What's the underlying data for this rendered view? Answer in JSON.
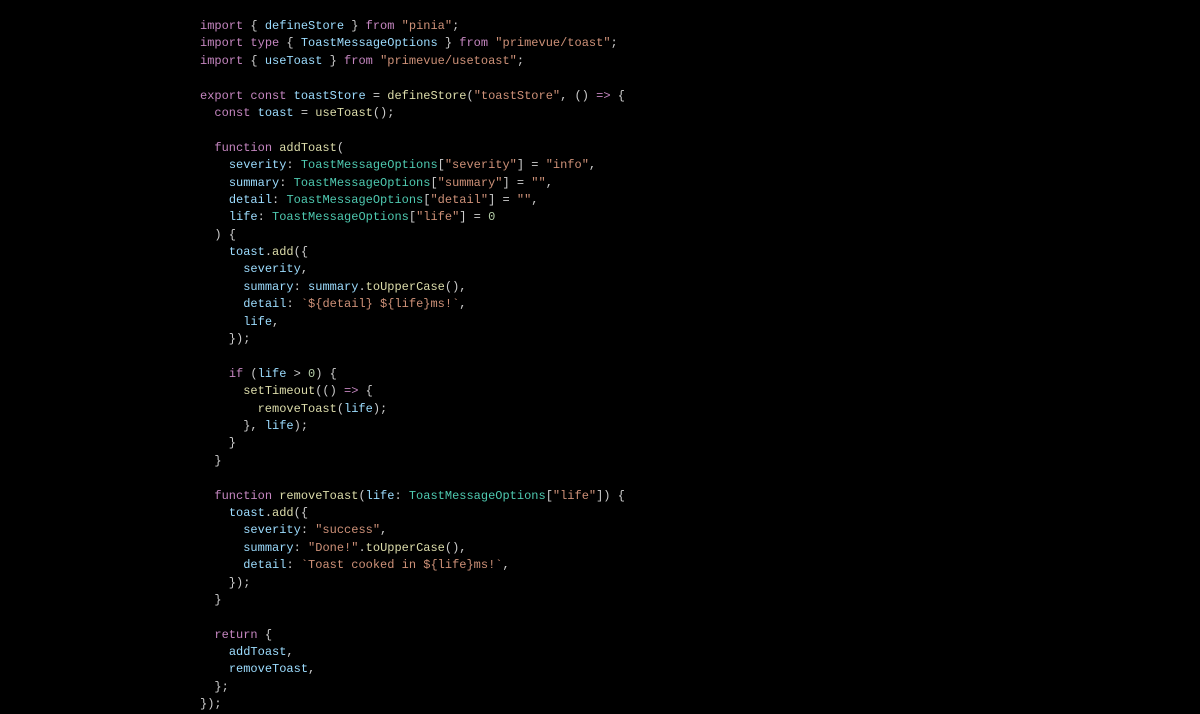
{
  "code": {
    "lines": [
      [
        {
          "c": "kw",
          "t": "import"
        },
        {
          "c": "pun",
          "t": " { "
        },
        {
          "c": "var",
          "t": "defineStore"
        },
        {
          "c": "pun",
          "t": " } "
        },
        {
          "c": "kw",
          "t": "from"
        },
        {
          "c": "pun",
          "t": " "
        },
        {
          "c": "str",
          "t": "\"pinia\""
        },
        {
          "c": "pun",
          "t": ";"
        }
      ],
      [
        {
          "c": "kw",
          "t": "import"
        },
        {
          "c": "pun",
          "t": " "
        },
        {
          "c": "kw",
          "t": "type"
        },
        {
          "c": "pun",
          "t": " { "
        },
        {
          "c": "var",
          "t": "ToastMessageOptions"
        },
        {
          "c": "pun",
          "t": " } "
        },
        {
          "c": "kw",
          "t": "from"
        },
        {
          "c": "pun",
          "t": " "
        },
        {
          "c": "str",
          "t": "\"primevue/toast\""
        },
        {
          "c": "pun",
          "t": ";"
        }
      ],
      [
        {
          "c": "kw",
          "t": "import"
        },
        {
          "c": "pun",
          "t": " { "
        },
        {
          "c": "var",
          "t": "useToast"
        },
        {
          "c": "pun",
          "t": " } "
        },
        {
          "c": "kw",
          "t": "from"
        },
        {
          "c": "pun",
          "t": " "
        },
        {
          "c": "str",
          "t": "\"primevue/usetoast\""
        },
        {
          "c": "pun",
          "t": ";"
        }
      ],
      [],
      [
        {
          "c": "kw",
          "t": "export"
        },
        {
          "c": "pun",
          "t": " "
        },
        {
          "c": "kw",
          "t": "const"
        },
        {
          "c": "pun",
          "t": " "
        },
        {
          "c": "var",
          "t": "toastStore"
        },
        {
          "c": "pun",
          "t": " = "
        },
        {
          "c": "fn",
          "t": "defineStore"
        },
        {
          "c": "pun",
          "t": "("
        },
        {
          "c": "str",
          "t": "\"toastStore\""
        },
        {
          "c": "pun",
          "t": ", () "
        },
        {
          "c": "kw",
          "t": "=>"
        },
        {
          "c": "pun",
          "t": " {"
        }
      ],
      [
        {
          "c": "pun",
          "t": "  "
        },
        {
          "c": "kw",
          "t": "const"
        },
        {
          "c": "pun",
          "t": " "
        },
        {
          "c": "var",
          "t": "toast"
        },
        {
          "c": "pun",
          "t": " = "
        },
        {
          "c": "fn",
          "t": "useToast"
        },
        {
          "c": "pun",
          "t": "();"
        }
      ],
      [],
      [
        {
          "c": "pun",
          "t": "  "
        },
        {
          "c": "kw",
          "t": "function"
        },
        {
          "c": "pun",
          "t": " "
        },
        {
          "c": "fn",
          "t": "addToast"
        },
        {
          "c": "pun",
          "t": "("
        }
      ],
      [
        {
          "c": "pun",
          "t": "    "
        },
        {
          "c": "var",
          "t": "severity"
        },
        {
          "c": "pun",
          "t": ": "
        },
        {
          "c": "typ",
          "t": "ToastMessageOptions"
        },
        {
          "c": "pun",
          "t": "["
        },
        {
          "c": "str",
          "t": "\"severity\""
        },
        {
          "c": "pun",
          "t": "] = "
        },
        {
          "c": "str",
          "t": "\"info\""
        },
        {
          "c": "pun",
          "t": ","
        }
      ],
      [
        {
          "c": "pun",
          "t": "    "
        },
        {
          "c": "var",
          "t": "summary"
        },
        {
          "c": "pun",
          "t": ": "
        },
        {
          "c": "typ",
          "t": "ToastMessageOptions"
        },
        {
          "c": "pun",
          "t": "["
        },
        {
          "c": "str",
          "t": "\"summary\""
        },
        {
          "c": "pun",
          "t": "] = "
        },
        {
          "c": "str",
          "t": "\"\""
        },
        {
          "c": "pun",
          "t": ","
        }
      ],
      [
        {
          "c": "pun",
          "t": "    "
        },
        {
          "c": "var",
          "t": "detail"
        },
        {
          "c": "pun",
          "t": ": "
        },
        {
          "c": "typ",
          "t": "ToastMessageOptions"
        },
        {
          "c": "pun",
          "t": "["
        },
        {
          "c": "str",
          "t": "\"detail\""
        },
        {
          "c": "pun",
          "t": "] = "
        },
        {
          "c": "str",
          "t": "\"\""
        },
        {
          "c": "pun",
          "t": ","
        }
      ],
      [
        {
          "c": "pun",
          "t": "    "
        },
        {
          "c": "var",
          "t": "life"
        },
        {
          "c": "pun",
          "t": ": "
        },
        {
          "c": "typ",
          "t": "ToastMessageOptions"
        },
        {
          "c": "pun",
          "t": "["
        },
        {
          "c": "str",
          "t": "\"life\""
        },
        {
          "c": "pun",
          "t": "] = "
        },
        {
          "c": "num",
          "t": "0"
        }
      ],
      [
        {
          "c": "pun",
          "t": "  ) {"
        }
      ],
      [
        {
          "c": "pun",
          "t": "    "
        },
        {
          "c": "var",
          "t": "toast"
        },
        {
          "c": "pun",
          "t": "."
        },
        {
          "c": "fn",
          "t": "add"
        },
        {
          "c": "pun",
          "t": "({"
        }
      ],
      [
        {
          "c": "pun",
          "t": "      "
        },
        {
          "c": "var",
          "t": "severity"
        },
        {
          "c": "pun",
          "t": ","
        }
      ],
      [
        {
          "c": "pun",
          "t": "      "
        },
        {
          "c": "var",
          "t": "summary"
        },
        {
          "c": "pun",
          "t": ": "
        },
        {
          "c": "var",
          "t": "summary"
        },
        {
          "c": "pun",
          "t": "."
        },
        {
          "c": "fn",
          "t": "toUpperCase"
        },
        {
          "c": "pun",
          "t": "(),"
        }
      ],
      [
        {
          "c": "pun",
          "t": "      "
        },
        {
          "c": "var",
          "t": "detail"
        },
        {
          "c": "pun",
          "t": ": "
        },
        {
          "c": "str",
          "t": "`${detail} ${life}ms!`"
        },
        {
          "c": "pun",
          "t": ","
        }
      ],
      [
        {
          "c": "pun",
          "t": "      "
        },
        {
          "c": "var",
          "t": "life"
        },
        {
          "c": "pun",
          "t": ","
        }
      ],
      [
        {
          "c": "pun",
          "t": "    });"
        }
      ],
      [],
      [
        {
          "c": "pun",
          "t": "    "
        },
        {
          "c": "kw",
          "t": "if"
        },
        {
          "c": "pun",
          "t": " ("
        },
        {
          "c": "var",
          "t": "life"
        },
        {
          "c": "pun",
          "t": " > "
        },
        {
          "c": "num",
          "t": "0"
        },
        {
          "c": "pun",
          "t": ") {"
        }
      ],
      [
        {
          "c": "pun",
          "t": "      "
        },
        {
          "c": "fn",
          "t": "setTimeout"
        },
        {
          "c": "pun",
          "t": "(() "
        },
        {
          "c": "kw",
          "t": "=>"
        },
        {
          "c": "pun",
          "t": " {"
        }
      ],
      [
        {
          "c": "pun",
          "t": "        "
        },
        {
          "c": "fn",
          "t": "removeToast"
        },
        {
          "c": "pun",
          "t": "("
        },
        {
          "c": "var",
          "t": "life"
        },
        {
          "c": "pun",
          "t": ");"
        }
      ],
      [
        {
          "c": "pun",
          "t": "      }, "
        },
        {
          "c": "var",
          "t": "life"
        },
        {
          "c": "pun",
          "t": ");"
        }
      ],
      [
        {
          "c": "pun",
          "t": "    }"
        }
      ],
      [
        {
          "c": "pun",
          "t": "  }"
        }
      ],
      [],
      [
        {
          "c": "pun",
          "t": "  "
        },
        {
          "c": "kw",
          "t": "function"
        },
        {
          "c": "pun",
          "t": " "
        },
        {
          "c": "fn",
          "t": "removeToast"
        },
        {
          "c": "pun",
          "t": "("
        },
        {
          "c": "var",
          "t": "life"
        },
        {
          "c": "pun",
          "t": ": "
        },
        {
          "c": "typ",
          "t": "ToastMessageOptions"
        },
        {
          "c": "pun",
          "t": "["
        },
        {
          "c": "str",
          "t": "\"life\""
        },
        {
          "c": "pun",
          "t": "]) {"
        }
      ],
      [
        {
          "c": "pun",
          "t": "    "
        },
        {
          "c": "var",
          "t": "toast"
        },
        {
          "c": "pun",
          "t": "."
        },
        {
          "c": "fn",
          "t": "add"
        },
        {
          "c": "pun",
          "t": "({"
        }
      ],
      [
        {
          "c": "pun",
          "t": "      "
        },
        {
          "c": "var",
          "t": "severity"
        },
        {
          "c": "pun",
          "t": ": "
        },
        {
          "c": "str",
          "t": "\"success\""
        },
        {
          "c": "pun",
          "t": ","
        }
      ],
      [
        {
          "c": "pun",
          "t": "      "
        },
        {
          "c": "var",
          "t": "summary"
        },
        {
          "c": "pun",
          "t": ": "
        },
        {
          "c": "str",
          "t": "\"Done!\""
        },
        {
          "c": "pun",
          "t": "."
        },
        {
          "c": "fn",
          "t": "toUpperCase"
        },
        {
          "c": "pun",
          "t": "(),"
        }
      ],
      [
        {
          "c": "pun",
          "t": "      "
        },
        {
          "c": "var",
          "t": "detail"
        },
        {
          "c": "pun",
          "t": ": "
        },
        {
          "c": "str",
          "t": "`Toast cooked in ${life}ms!`"
        },
        {
          "c": "pun",
          "t": ","
        }
      ],
      [
        {
          "c": "pun",
          "t": "    });"
        }
      ],
      [
        {
          "c": "pun",
          "t": "  }"
        }
      ],
      [],
      [
        {
          "c": "pun",
          "t": "  "
        },
        {
          "c": "kw",
          "t": "return"
        },
        {
          "c": "pun",
          "t": " {"
        }
      ],
      [
        {
          "c": "pun",
          "t": "    "
        },
        {
          "c": "var",
          "t": "addToast"
        },
        {
          "c": "pun",
          "t": ","
        }
      ],
      [
        {
          "c": "pun",
          "t": "    "
        },
        {
          "c": "var",
          "t": "removeToast"
        },
        {
          "c": "pun",
          "t": ","
        }
      ],
      [
        {
          "c": "pun",
          "t": "  };"
        }
      ],
      [
        {
          "c": "pun",
          "t": "});"
        }
      ]
    ]
  }
}
